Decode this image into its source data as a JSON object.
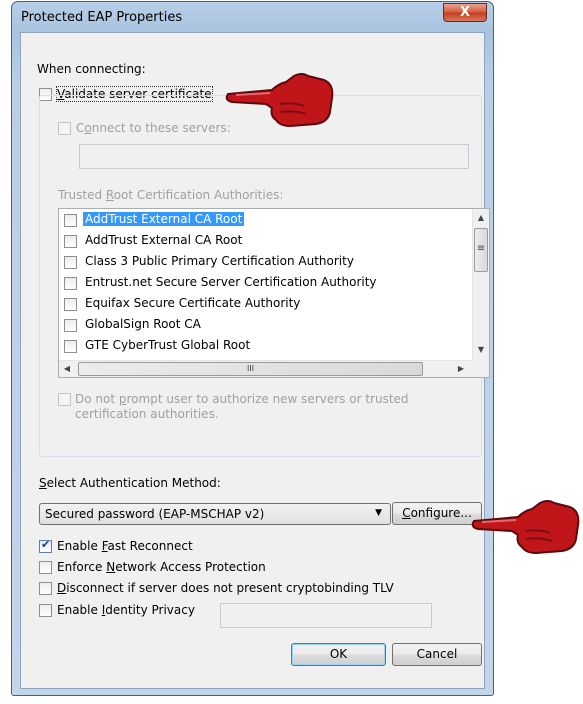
{
  "window": {
    "title": "Protected EAP Properties",
    "close_glyph": "X"
  },
  "when_connecting": "When connecting:",
  "validate_cert": {
    "label": "Validate server certificate",
    "underline_char": "V",
    "rest": "alidate server certificate",
    "checked": false
  },
  "connect_servers": {
    "label": "Connect to these servers:",
    "underline_char": "o",
    "before": "C",
    "after": "nnect to these servers:",
    "value": ""
  },
  "trusted_root": {
    "label": "Trusted Root Certification Authorities:",
    "before": "Trusted ",
    "underline_char": "R",
    "after": "oot Certification Authorities:",
    "items": [
      {
        "label": "AddTrust External CA Root",
        "selected": true
      },
      {
        "label": "AddTrust External CA Root",
        "selected": false
      },
      {
        "label": "Class 3 Public Primary Certification Authority",
        "selected": false
      },
      {
        "label": "Entrust.net Secure Server Certification Authority",
        "selected": false
      },
      {
        "label": "Equifax Secure Certificate Authority",
        "selected": false
      },
      {
        "label": "GlobalSign Root CA",
        "selected": false
      },
      {
        "label": "GTE CyberTrust Global Root",
        "selected": false
      }
    ],
    "scroll_up_glyph": "▲",
    "scroll_down_glyph": "▼",
    "scroll_left_glyph": "◀",
    "scroll_right_glyph": "▶",
    "vthumb_glyph": "≡",
    "hthumb_glyph": "III"
  },
  "no_prompt": {
    "before": "Do not ",
    "underline_char": "p",
    "after": "rompt user to authorize new servers or trusted",
    "line2": "certification authorities."
  },
  "auth_method": {
    "before": "",
    "underline_char": "S",
    "after": "elect Authentication Method:",
    "selected": "Secured password (EAP-MSCHAP v2)",
    "arrow_glyph": "▼"
  },
  "configure_button": {
    "underline_char": "C",
    "rest": "onfigure..."
  },
  "options": [
    {
      "before": "Enable ",
      "underline_char": "F",
      "after": "ast Reconnect",
      "checked": true
    },
    {
      "before": "Enforce ",
      "underline_char": "N",
      "after": "etwork Access Protection",
      "checked": false
    },
    {
      "before": "",
      "underline_char": "D",
      "after": "isconnect if server does not present cryptobinding TLV",
      "checked": false
    },
    {
      "before": "Enable ",
      "underline_char": "I",
      "after": "dentity Privacy",
      "checked": false
    }
  ],
  "identity_value": "",
  "ok_label": "OK",
  "cancel_label": "Cancel",
  "colors": {
    "selection": "#3399ff",
    "pointer_hand": "#c0161a"
  },
  "icons": {
    "pointer": "pointing-hand-icon"
  }
}
